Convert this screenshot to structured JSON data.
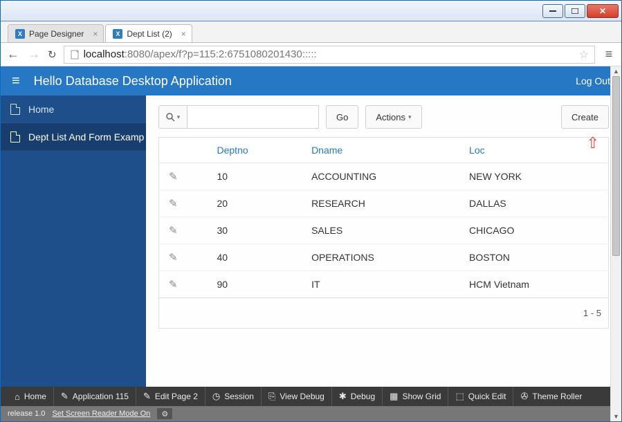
{
  "browser": {
    "tabs": [
      {
        "label": "Page Designer"
      },
      {
        "label": "Dept List (2)"
      }
    ],
    "url_host": "localhost",
    "url_path": ":8080/apex/f?p=115:2:6751080201430:::::"
  },
  "app": {
    "title": "Hello Database Desktop Application",
    "logout": "Log Out"
  },
  "sidebar": {
    "items": [
      {
        "label": "Home"
      },
      {
        "label": "Dept List And Form Examp"
      }
    ]
  },
  "toolbar": {
    "search_value": "",
    "go": "Go",
    "actions": "Actions",
    "create": "Create"
  },
  "report": {
    "columns": [
      "Deptno",
      "Dname",
      "Loc"
    ],
    "rows": [
      {
        "deptno": "10",
        "dname": "ACCOUNTING",
        "loc": "NEW YORK"
      },
      {
        "deptno": "20",
        "dname": "RESEARCH",
        "loc": "DALLAS"
      },
      {
        "deptno": "30",
        "dname": "SALES",
        "loc": "CHICAGO"
      },
      {
        "deptno": "40",
        "dname": "OPERATIONS",
        "loc": "BOSTON"
      },
      {
        "deptno": "90",
        "dname": "IT",
        "loc": "HCM Vietnam"
      }
    ],
    "pagination": "1 - 5"
  },
  "devtoolbar": {
    "items": [
      "Home",
      "Application 115",
      "Edit Page 2",
      "Session",
      "View Debug",
      "Debug",
      "Show Grid",
      "Quick Edit",
      "Theme Roller"
    ]
  },
  "status": {
    "release": "release 1.0",
    "screen_reader": "Set Screen Reader Mode On"
  }
}
